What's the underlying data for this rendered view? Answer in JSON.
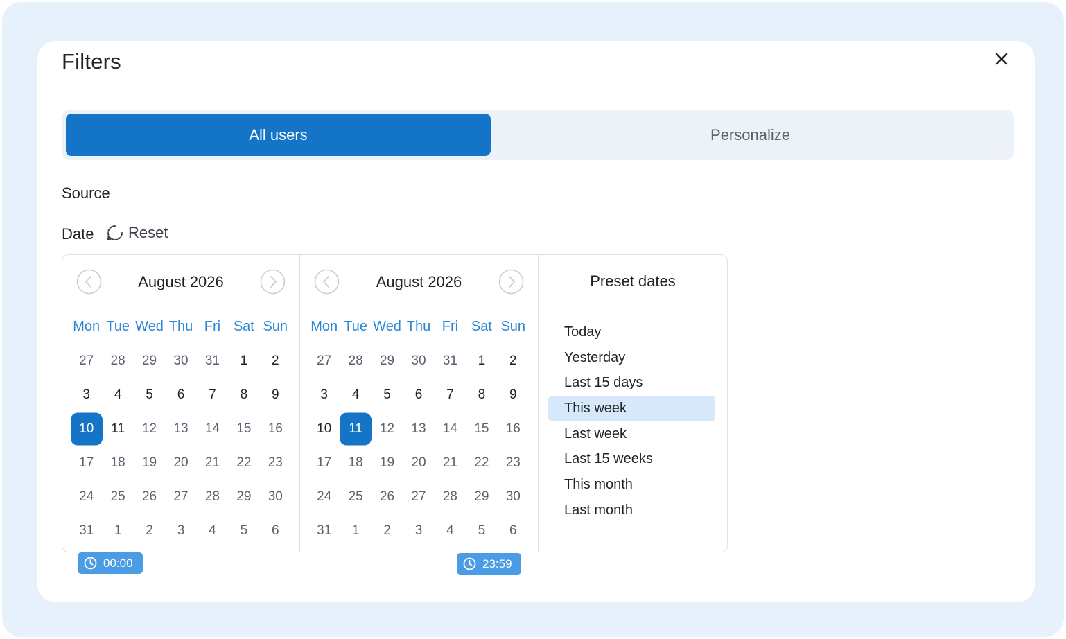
{
  "dialog": {
    "title": "Filters",
    "close_icon": "close-icon"
  },
  "tabs": [
    {
      "label": "All users",
      "active": true
    },
    {
      "label": "Personalize",
      "active": false
    }
  ],
  "sections": {
    "source_label": "Source",
    "date_label": "Date",
    "reset_label": "Reset"
  },
  "weekdays": [
    "Mon",
    "Tue",
    "Wed",
    "Thu",
    "Fri",
    "Sat",
    "Sun"
  ],
  "calendars": [
    {
      "title": "August 2026",
      "selected_day": "10",
      "days": [
        "27",
        "28",
        "29",
        "30",
        "31",
        "1",
        "2",
        "3",
        "4",
        "5",
        "6",
        "7",
        "8",
        "9",
        "10",
        "11",
        "12",
        "13",
        "14",
        "15",
        "16",
        "17",
        "18",
        "19",
        "20",
        "21",
        "22",
        "23",
        "24",
        "25",
        "26",
        "27",
        "28",
        "29",
        "30",
        "31",
        "1",
        "2",
        "3",
        "4",
        "5",
        "6"
      ],
      "current_month_range": [
        5,
        35
      ],
      "highlight_dark": [
        "1",
        "2",
        "3",
        "4",
        "5",
        "6",
        "7",
        "8",
        "9",
        "11"
      ],
      "time": "00:00"
    },
    {
      "title": "August 2026",
      "selected_day": "11",
      "days": [
        "27",
        "28",
        "29",
        "30",
        "31",
        "1",
        "2",
        "3",
        "4",
        "5",
        "6",
        "7",
        "8",
        "9",
        "10",
        "11",
        "12",
        "13",
        "14",
        "15",
        "16",
        "17",
        "18",
        "19",
        "20",
        "21",
        "22",
        "23",
        "24",
        "25",
        "26",
        "27",
        "28",
        "29",
        "30",
        "31",
        "1",
        "2",
        "3",
        "4",
        "5",
        "6"
      ],
      "current_month_range": [
        5,
        35
      ],
      "highlight_dark": [
        "1",
        "2",
        "3",
        "4",
        "5",
        "6",
        "7",
        "8",
        "9",
        "10"
      ],
      "time": "23:59"
    }
  ],
  "presets": {
    "title": "Preset dates",
    "items": [
      "Today",
      "Yesterday",
      "Last 15 days",
      "This week",
      "Last week",
      "Last 15 weeks",
      "This month",
      "Last month"
    ],
    "active": "This week"
  },
  "colors": {
    "primary": "#1374c8",
    "weekday": "#2a86d6",
    "preset_active_bg": "#d6e8fa",
    "time_badge": "#4a9ce4",
    "outer_bg": "#e6f1fc"
  }
}
